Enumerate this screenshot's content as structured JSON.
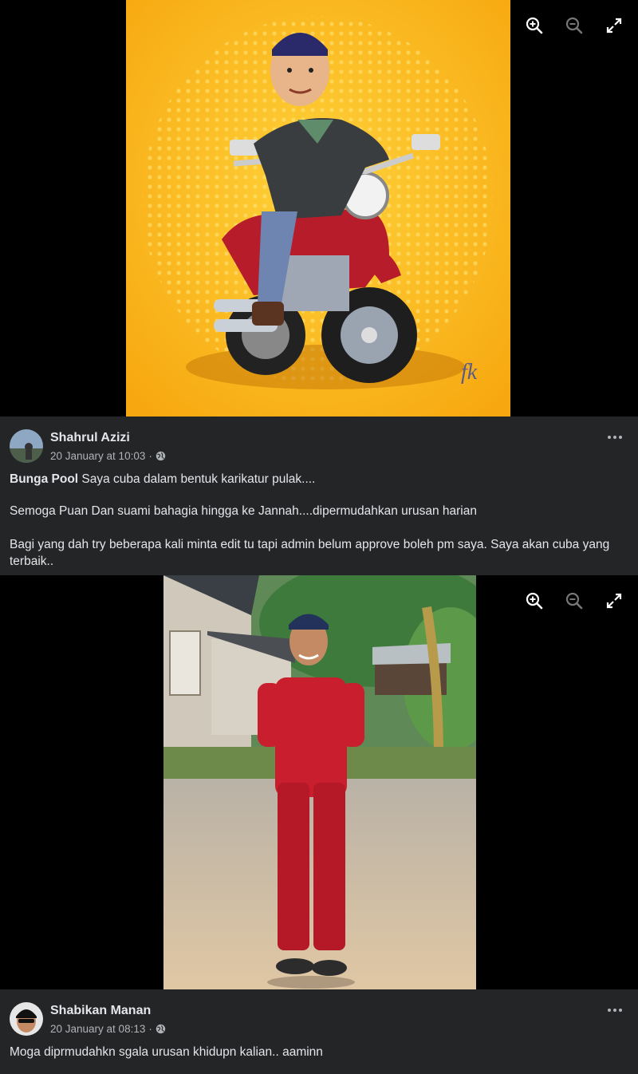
{
  "viewer1": {
    "signature": "fk",
    "toolbar": {
      "zoom_in": "zoom-in-icon",
      "zoom_out": "zoom-out-icon",
      "fullscreen": "expand-icon"
    }
  },
  "comment1": {
    "author": "Shahrul Azizi",
    "timestamp": "20 January at 10:03",
    "separator": "·",
    "mention": "Bunga Pool",
    "line1": "Saya cuba dalam bentuk karikatur pulak....",
    "line2": "Semoga Puan Dan suami bahagia hingga ke Jannah....dipermudahkan urusan harian",
    "line3": "Bagi yang dah try beberapa kali minta edit tu tapi admin belum approve boleh pm saya. Saya akan cuba yang terbaik.."
  },
  "viewer2": {
    "toolbar": {
      "zoom_in": "zoom-in-icon",
      "zoom_out": "zoom-out-icon",
      "fullscreen": "expand-icon"
    }
  },
  "comment2": {
    "author": "Shabikan Manan",
    "timestamp": "20 January at 08:13",
    "separator": "·",
    "text": "Moga diprmudahkn sgala urusan khidupn kalian.. aaminn"
  },
  "colors": {
    "background": "#000000",
    "panel": "#242526",
    "text_primary": "#e4e6eb",
    "text_secondary": "#b0b3b8",
    "caricature_bg": "#ffb81c",
    "outfit_red": "#c81e2d"
  }
}
